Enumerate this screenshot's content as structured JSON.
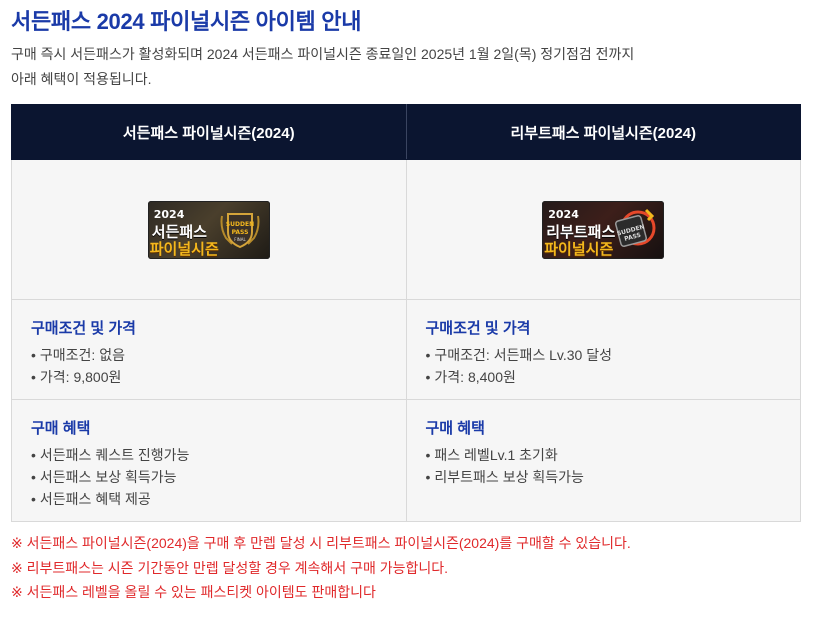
{
  "title": "서든패스 2024 파이널시즌 아이템 안내",
  "intro": [
    "구매 즉시 서든패스가 활성화되며 2024 서든패스 파이널시즌 종료일인 2025년 1월 2일(목) 정기점검 전까지",
    "아래 혜택이 적용됩니다."
  ],
  "columns": [
    {
      "header": "서든패스 파이널시즌(2024)",
      "badge": {
        "year": "2024",
        "name": "서든패스",
        "sub": "파이널시즌",
        "emblem_text": "SUDDEN PASS",
        "emblem_sub": "FINAL"
      },
      "condition_title": "구매조건 및 가격",
      "conditions": [
        "구매조건: 없음",
        "가격: 9,800원"
      ],
      "benefit_title": "구매 혜택",
      "benefits": [
        "서든패스 퀘스트 진행가능",
        "서든패스 보상 획득가능",
        "서든패스 혜택 제공"
      ]
    },
    {
      "header": "리부트패스 파이널시즌(2024)",
      "badge": {
        "year": "2024",
        "name": "리부트패스",
        "sub": "파이널시즌",
        "emblem_text": "SUDDEN PASS",
        "emblem_sub": ""
      },
      "condition_title": "구매조건 및 가격",
      "conditions": [
        "구매조건: 서든패스 Lv.30 달성",
        "가격: 8,400원"
      ],
      "benefit_title": "구매 혜택",
      "benefits": [
        "패스 레벨Lv.1 초기화",
        "리부트패스 보상 획득가능"
      ]
    }
  ],
  "notes": [
    "※ 서든패스 파이널시즌(2024)을 구매 후 만렙 달성 시 리부트패스 파이널시즌(2024)를 구매할 수 있습니다.",
    "※  리부트패스는 시즌 기간동안 만렙 달성할 경우 계속해서 구매 가능합니다.",
    "※ 서든패스 레벨을 올릴 수 있는 패스티켓 아이템도 판매합니다"
  ],
  "colors": {
    "title": "#1a3aa8",
    "header_bg": "#0b1530",
    "note": "#e0292b",
    "accent_gold": "#f4b81d"
  },
  "bullet": "•"
}
